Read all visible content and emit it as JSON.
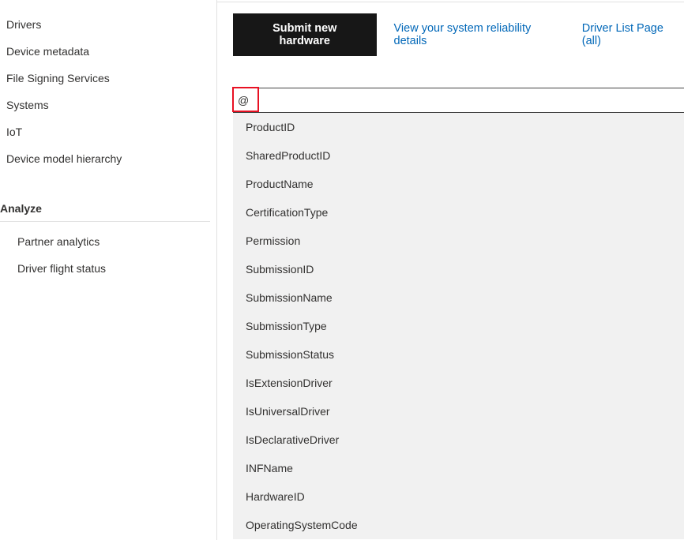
{
  "sidebar": {
    "items": [
      {
        "label": "Drivers"
      },
      {
        "label": "Device metadata"
      },
      {
        "label": "File Signing Services"
      },
      {
        "label": "Systems"
      },
      {
        "label": "IoT"
      },
      {
        "label": "Device model hierarchy"
      }
    ],
    "section_header": "Analyze",
    "subitems": [
      {
        "label": "Partner analytics"
      },
      {
        "label": "Driver flight status"
      }
    ]
  },
  "actions": {
    "submit_label": "Submit new hardware",
    "reliability_link": "View your system reliability details",
    "driver_list_link": "Driver List Page (all)"
  },
  "search": {
    "value": "@"
  },
  "dropdown": {
    "items": [
      "ProductID",
      "SharedProductID",
      "ProductName",
      "CertificationType",
      "Permission",
      "SubmissionID",
      "SubmissionName",
      "SubmissionType",
      "SubmissionStatus",
      "IsExtensionDriver",
      "IsUniversalDriver",
      "IsDeclarativeDriver",
      "INFName",
      "HardwareID",
      "OperatingSystemCode"
    ]
  }
}
